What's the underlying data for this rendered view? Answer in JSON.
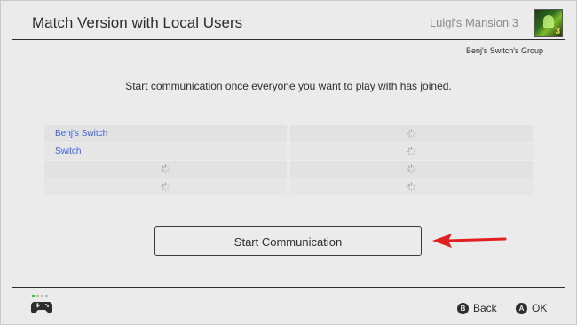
{
  "header": {
    "title": "Match Version with Local Users",
    "game_title": "Luigi's Mansion 3",
    "group_name": "Benj's Switch's Group"
  },
  "message": "Start communication once everyone you want to play with has joined.",
  "players": {
    "rows": [
      {
        "left": "Benj's Switch",
        "right_status": "loading-spinner-icon"
      },
      {
        "left": "Switch",
        "right_status": "loading-spinner-icon"
      },
      {
        "left": "",
        "right_status": "loading-spinner-icon"
      },
      {
        "left": "",
        "right_status": "loading-spinner-icon"
      }
    ]
  },
  "start_button": {
    "label": "Start Communication"
  },
  "annotation": {
    "color": "#e02020",
    "icon": "red-arrow-icon"
  },
  "footer": {
    "back": {
      "glyph": "B",
      "label": "Back"
    },
    "ok": {
      "glyph": "A",
      "label": "OK"
    }
  },
  "colors": {
    "player_name": "#3d5fd8",
    "background": "#ebebeb"
  }
}
